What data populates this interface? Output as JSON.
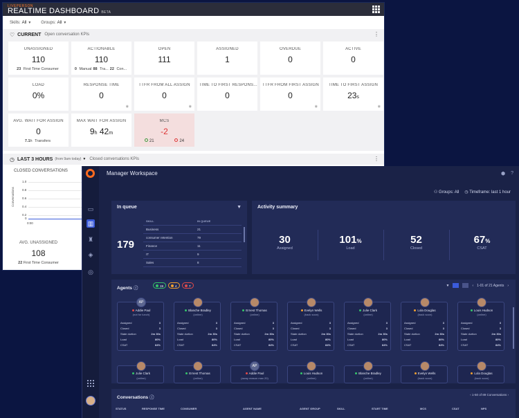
{
  "realtime": {
    "brand": "LIVEPERSON",
    "title": "REALTIME DASHBOARD",
    "beta": "BETA",
    "filters": {
      "skills_label": "Skills:",
      "skills_value": "All",
      "groups_label": "Groups:",
      "groups_value": "All"
    },
    "current": {
      "label": "CURRENT",
      "subtitle": "Open conversation KPIs"
    },
    "kpis": {
      "unassigned": {
        "label": "UNASSIGNED",
        "value": "110",
        "sub_value": "23",
        "sub_text": "First Time Consumer"
      },
      "actionable": {
        "label": "ACTIONABLE",
        "value": "110",
        "sub1_value": "0",
        "sub1_text": "Manual",
        "sub2_value": "88",
        "sub2_text": "Tra...",
        "sub3_value": "22",
        "sub3_text": "Con..."
      },
      "open": {
        "label": "OPEN",
        "value": "111"
      },
      "assigned": {
        "label": "ASSIGNED",
        "value": "1"
      },
      "overdue": {
        "label": "OVERDUE",
        "value": "0"
      },
      "active": {
        "label": "ACTIVE",
        "value": "0"
      },
      "load": {
        "label": "LOAD",
        "value": "0%"
      },
      "response_time": {
        "label": "RESPONSE TIME",
        "value": "0"
      },
      "ttfr_all": {
        "label": "TTFR FROM ALL ASSIGN",
        "value": "0"
      },
      "ttfr_response": {
        "label": "TIME TO FIRST RESPONS...",
        "value": "0"
      },
      "ttfr_first": {
        "label": "TTFR FROM FIRST ASSIGN",
        "value": "0"
      },
      "time_first_assign": {
        "label": "TIME TO FIRST ASSIGN",
        "value": "23",
        "unit": "s"
      },
      "avg_wait": {
        "label": "AVG. WAIT FOR ASSIGN",
        "value": "0",
        "sub_value": "7.1",
        "sub_unit": "h",
        "sub_text": "Transfers"
      },
      "max_wait": {
        "label": "MAX WAIT FOR ASSIGN",
        "value_h": "9",
        "unit_h": "h",
        "value_m": "42",
        "unit_m": "m"
      },
      "mcs": {
        "label": "MCS",
        "value": "-2",
        "positive": "21",
        "negative": "24"
      }
    },
    "last3": {
      "label": "LAST 3 HOURS",
      "range": "(from 9am today)",
      "subtitle": "Closed conversations KPIs"
    },
    "closed_chart": {
      "title": "CLOSED CONVERSATIONS",
      "ylabel": "Conversations",
      "yticks": [
        "1.0",
        "0.8",
        "0.6",
        "0.4",
        "0.2",
        "0"
      ],
      "xtick": "0:00"
    },
    "avg_unassigned": {
      "label": "AVG. UNASSIGNED",
      "value": "108",
      "sub_value": "22",
      "sub_text": "First Time Consumer"
    }
  },
  "manager": {
    "title": "Manager Workspace",
    "groups": "Groups: All",
    "timeframe": "Timeframe: last 1 hour",
    "in_queue": {
      "title": "In queue",
      "total": "179",
      "col_skill": "SKILL",
      "col_count": "IN QUEUE",
      "rows": [
        {
          "skill": "Business",
          "count": "21"
        },
        {
          "skill": "consumer retention",
          "count": "79"
        },
        {
          "skill": "Finance",
          "count": "11"
        },
        {
          "skill": "IT",
          "count": "9"
        },
        {
          "skill": "Sales",
          "count": "8"
        }
      ]
    },
    "activity": {
      "title": "Activity summary",
      "assigned_value": "30",
      "assigned_label": "Assigned",
      "load_value": "101",
      "load_unit": "%",
      "load_label": "Load",
      "closed_value": "52",
      "closed_label": "Closed",
      "csat_value": "67",
      "csat_unit": "%",
      "csat_label": "CSAT"
    },
    "agents": {
      "title": "Agents",
      "pill_online": "19",
      "pill_back": "4",
      "pill_away": "7",
      "pager": "1-01 of 21 Agents",
      "row_labels": [
        "Assigned",
        "Closed",
        "State durtion",
        "Load",
        "CSAT"
      ],
      "cards": [
        {
          "name": "Addie Paul",
          "status": "(not for lunch)",
          "initials": "AP",
          "dot": "#e24a4a",
          "vals": [
            "3",
            "3",
            "2m 30s",
            "80%",
            "84%"
          ]
        },
        {
          "name": "Blanche Bradley",
          "status": "(online)",
          "initials": "",
          "dot": "#35c46a",
          "vals": [
            "3",
            "3",
            "2m 30s",
            "80%",
            "84%"
          ]
        },
        {
          "name": "Ernest Thomas",
          "status": "(online)",
          "initials": "",
          "dot": "#35c46a",
          "vals": [
            "3",
            "3",
            "2m 30s",
            "80%",
            "84%"
          ]
        },
        {
          "name": "Evelyn Wells",
          "status": "(back soon)",
          "initials": "",
          "dot": "#f0a030",
          "vals": [
            "3",
            "3",
            "2m 30s",
            "80%",
            "84%"
          ]
        },
        {
          "name": "Julie Clark",
          "status": "(online)",
          "initials": "",
          "dot": "#35c46a",
          "vals": [
            "3",
            "3",
            "2m 30s",
            "80%",
            "84%"
          ]
        },
        {
          "name": "Lola Douglas",
          "status": "(back soon)",
          "initials": "",
          "dot": "#f0a030",
          "vals": [
            "3",
            "3",
            "2m 30s",
            "80%",
            "84%"
          ]
        },
        {
          "name": "Louis Hudson",
          "status": "(online)",
          "initials": "",
          "dot": "#35c46a",
          "vals": [
            "3",
            "3",
            "2m 30s",
            "80%",
            "84%"
          ]
        }
      ],
      "cards2": [
        {
          "name": "Julie Clark",
          "status": "(online)",
          "initials": "",
          "dot": "#35c46a"
        },
        {
          "name": "Ernest Thomas",
          "status": "(online)",
          "initials": "",
          "dot": "#35c46a"
        },
        {
          "name": "Addie Paul",
          "status": "(away reason max 20)",
          "initials": "AP",
          "dot": "#e24a4a"
        },
        {
          "name": "Louis Hudson",
          "status": "(online)",
          "initials": "",
          "dot": "#35c46a"
        },
        {
          "name": "Blanche Bradley",
          "status": "(online)",
          "initials": "",
          "dot": "#35c46a"
        },
        {
          "name": "Evelyn Wells",
          "status": "(back soon)",
          "initials": "",
          "dot": "#f0a030"
        },
        {
          "name": "Lola Douglas",
          "status": "(back soon)",
          "initials": "",
          "dot": "#f0a030"
        }
      ]
    },
    "conversations": {
      "title": "Conversations",
      "pager": "1-50 of 89 Conversations",
      "columns": [
        "STATUS",
        "RESPONSE TIME",
        "CONSUMER",
        "AGENT NAME",
        "AGENT GROUP",
        "SKILL",
        "START TIME",
        "MCS",
        "CSAT",
        "NPS"
      ]
    }
  },
  "colors": {
    "accent": "#3b5bdb",
    "brand_orange": "#ff6a1f",
    "online": "#35c46a",
    "back_soon": "#f0a030",
    "away": "#e24a4a",
    "mcs_negative": "#d33333"
  }
}
